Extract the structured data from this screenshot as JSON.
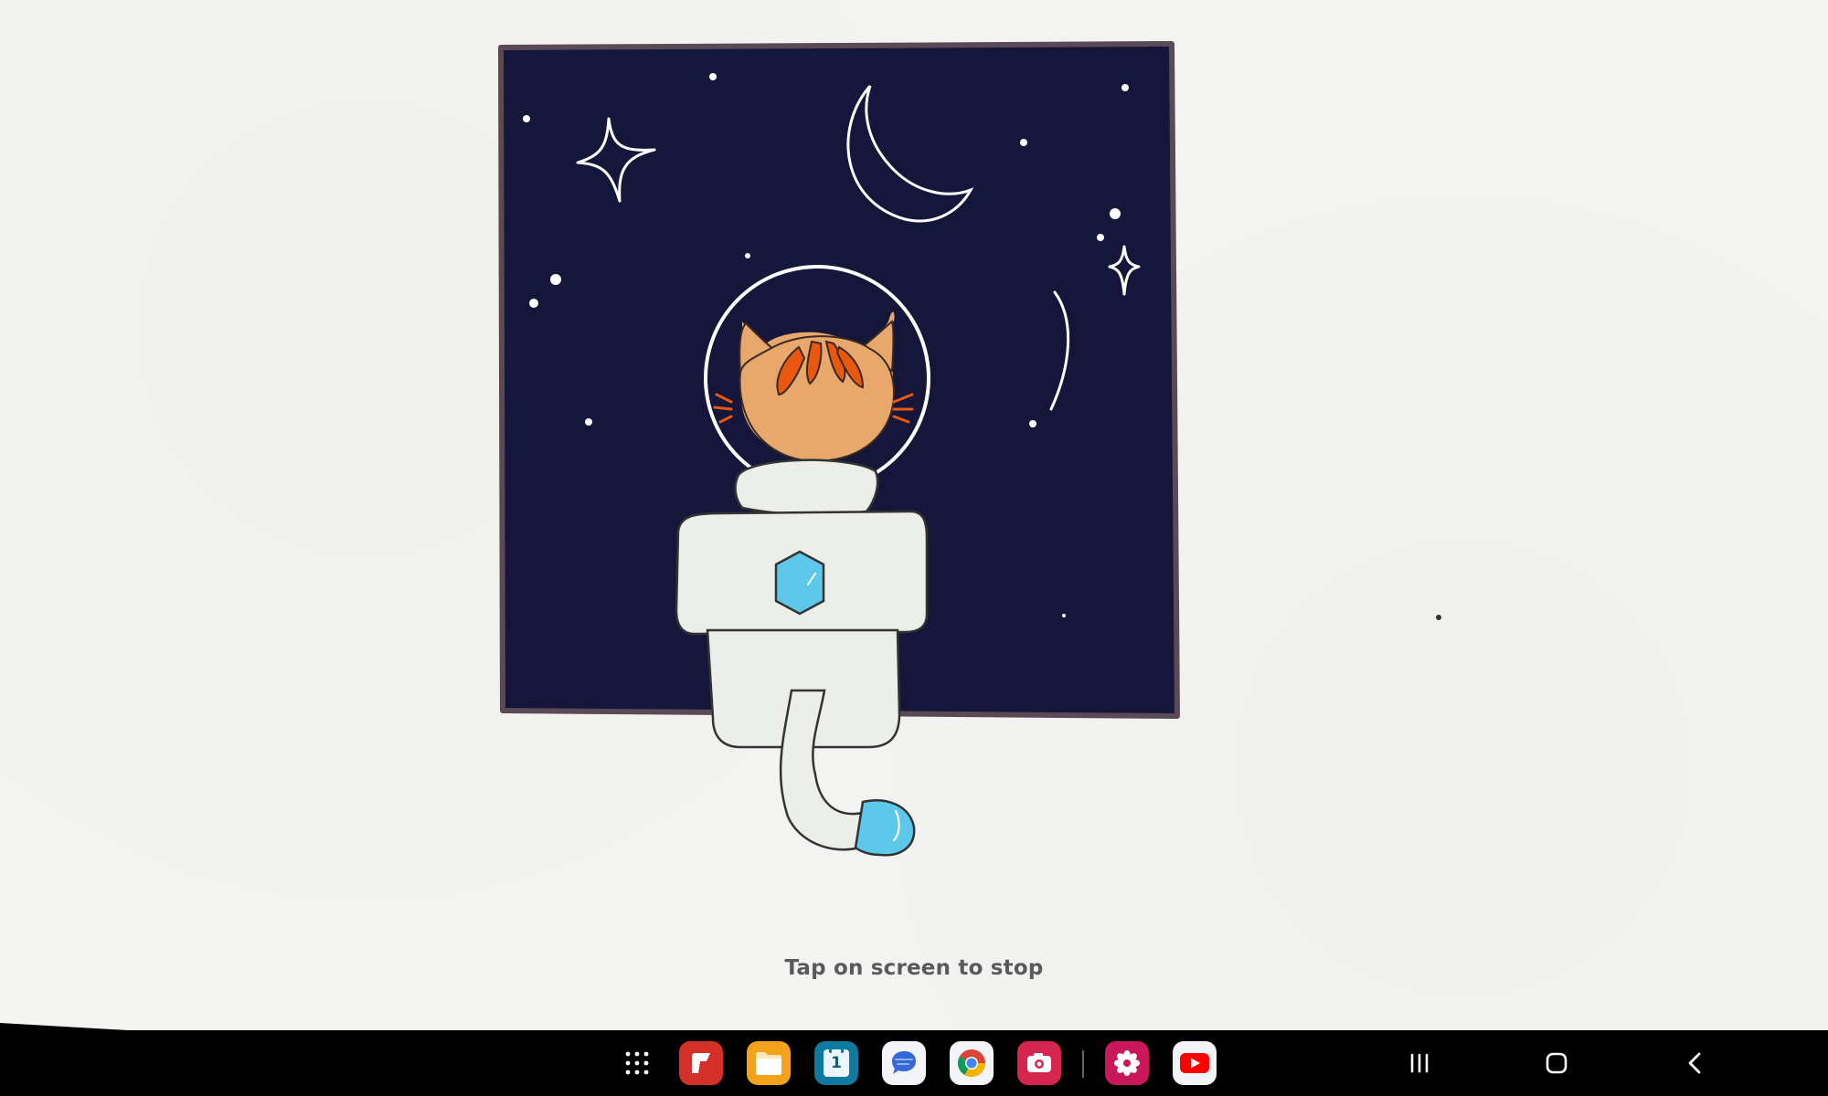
{
  "screen": {
    "stop_hint": "Tap on screen to stop",
    "background_color": "#f3f3f1"
  },
  "artwork": {
    "subject": "astronaut-cat-looking-at-night-sky",
    "sky_color": "#16163a",
    "frame_color": "#5a4a55",
    "fur_color": "#e8a86c",
    "stripe_color": "#e8580f",
    "suit_color": "#eceeea",
    "gem_color": "#5ec8ea"
  },
  "taskbar": {
    "apps": [
      {
        "name": "app-drawer",
        "icon": "grid-icon"
      },
      {
        "name": "flipboard",
        "icon": "flipboard-icon",
        "color": "#d3302a"
      },
      {
        "name": "my-files",
        "icon": "folder-icon",
        "color": "#f2a21b"
      },
      {
        "name": "calendar",
        "icon": "calendar-icon",
        "color": "#0e7aa0",
        "label": "1"
      },
      {
        "name": "messages",
        "icon": "chat-icon",
        "color": "#f2f4f8"
      },
      {
        "name": "chrome",
        "icon": "chrome-icon",
        "color": "#f2f4f8"
      },
      {
        "name": "screen-recorder",
        "icon": "camera-icon",
        "color": "#d6254e"
      },
      {
        "name": "gallery",
        "icon": "flower-icon",
        "color": "#c8185a"
      },
      {
        "name": "youtube",
        "icon": "youtube-icon",
        "color": "#f2f4f8"
      }
    ],
    "nav": [
      {
        "name": "recents",
        "icon": "recents-icon"
      },
      {
        "name": "home",
        "icon": "home-icon"
      },
      {
        "name": "back",
        "icon": "back-icon"
      }
    ]
  }
}
